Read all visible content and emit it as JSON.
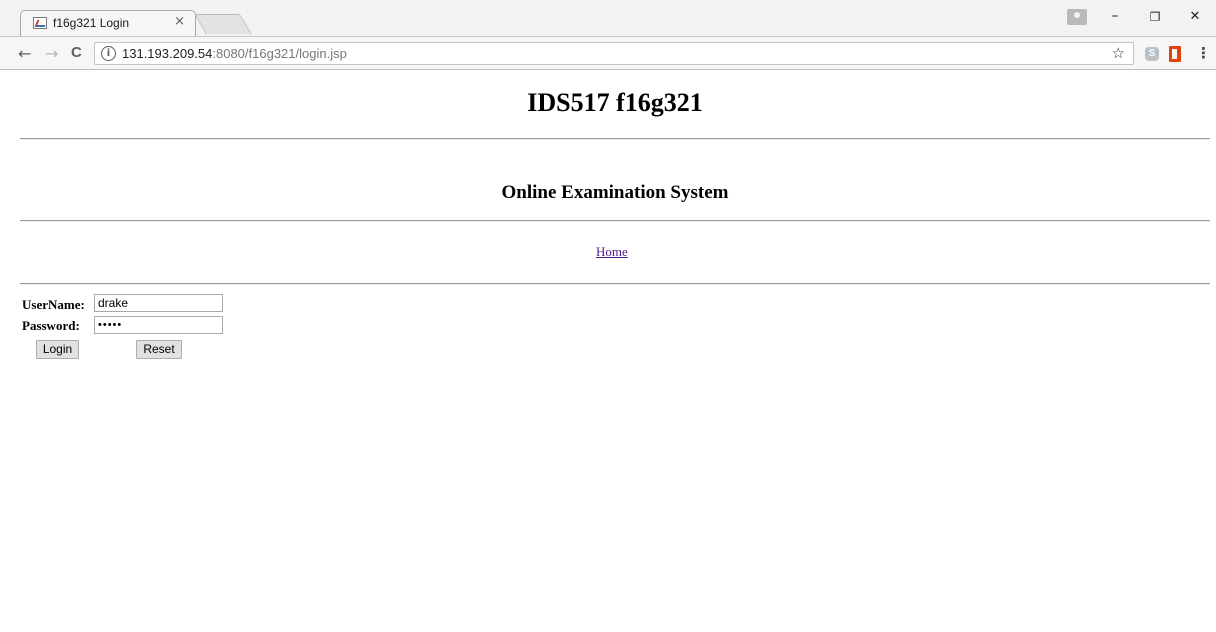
{
  "browser": {
    "tab_title": "f16g321 Login",
    "tab_close": "×",
    "url_host": "131.193.209.54",
    "url_rest": ":8080/f16g321/login.jsp",
    "info_icon_glyph": "i",
    "star_glyph": "☆",
    "back_glyph": "←",
    "forward_glyph": "→",
    "reload_glyph": "C",
    "menu_glyph": "⋮",
    "minimize_glyph": "–",
    "restore_glyph": "❐",
    "close_glyph": "✕",
    "skype_glyph": "S"
  },
  "page": {
    "title": "IDS517 f16g321",
    "subtitle": "Online Examination System",
    "home_link": "Home"
  },
  "form": {
    "username_label": "UserName:",
    "username_value": "drake",
    "password_label": "Password:",
    "password_value": "•••••",
    "login_label": "Login",
    "reset_label": "Reset"
  },
  "colors": {
    "link_visited": "#551a8b",
    "rule": "#9a9a9a",
    "chrome_bg": "#f2f2f2",
    "office_icon": "#e3420b"
  }
}
